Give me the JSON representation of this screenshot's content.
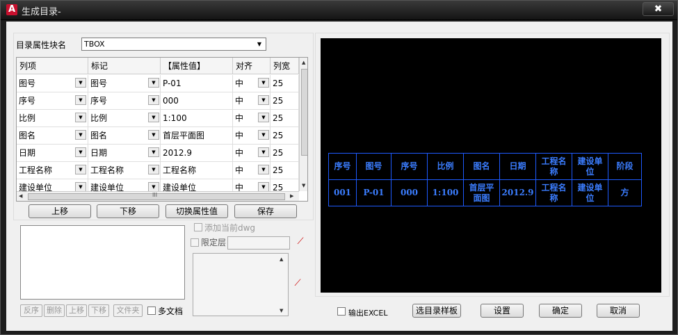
{
  "window": {
    "title": "生成目录-",
    "app_icon": "autocad-a-icon",
    "close_glyph": "✖"
  },
  "block_label": "目录属性块名",
  "block_value": "TBOX",
  "grid": {
    "headers": [
      "列项",
      "标记",
      "【属性值】",
      "对齐",
      "列宽"
    ],
    "rows": [
      [
        "图号",
        "图号",
        "P-01",
        "中",
        "25"
      ],
      [
        "序号",
        "序号",
        "000",
        "中",
        "25"
      ],
      [
        "比例",
        "比例",
        "1:100",
        "中",
        "25"
      ],
      [
        "图名",
        "图名",
        "首层平面图",
        "中",
        "25"
      ],
      [
        "日期",
        "日期",
        "2012.9",
        "中",
        "25"
      ],
      [
        "工程名称",
        "工程名称",
        "工程名称",
        "中",
        "25"
      ],
      [
        "建设单位",
        "建设单位",
        "建设单位",
        "中",
        "25"
      ]
    ],
    "hscroll_grip": "III"
  },
  "buttons": {
    "move_up": "上移",
    "move_down": "下移",
    "switch_attr": "切换属性值",
    "save": "保存"
  },
  "file_buttons": [
    "反序",
    "删除",
    "上移",
    "下移",
    "文件夹"
  ],
  "multi_doc": "多文档",
  "add_current_dwg": "添加当前dwg",
  "limit_layer": "限定层",
  "preview_table": {
    "header": [
      "序号",
      "图号",
      "序号",
      "比例",
      "图名",
      "日期",
      "工程名称",
      "建设单位",
      "阶段"
    ],
    "row": [
      "001",
      "P-01",
      "000",
      "1:100",
      "首层平面图",
      "2012.9",
      "工程名称",
      "建设单位",
      "方"
    ]
  },
  "footer": {
    "export_excel": "输出EXCEL",
    "select_template": "选目录样板",
    "settings": "设置",
    "ok": "确定",
    "cancel": "取消"
  },
  "colors": {
    "preview_line": "#1e5bff",
    "preview_text": "#3b7dff",
    "preview_bg": "#000000"
  }
}
